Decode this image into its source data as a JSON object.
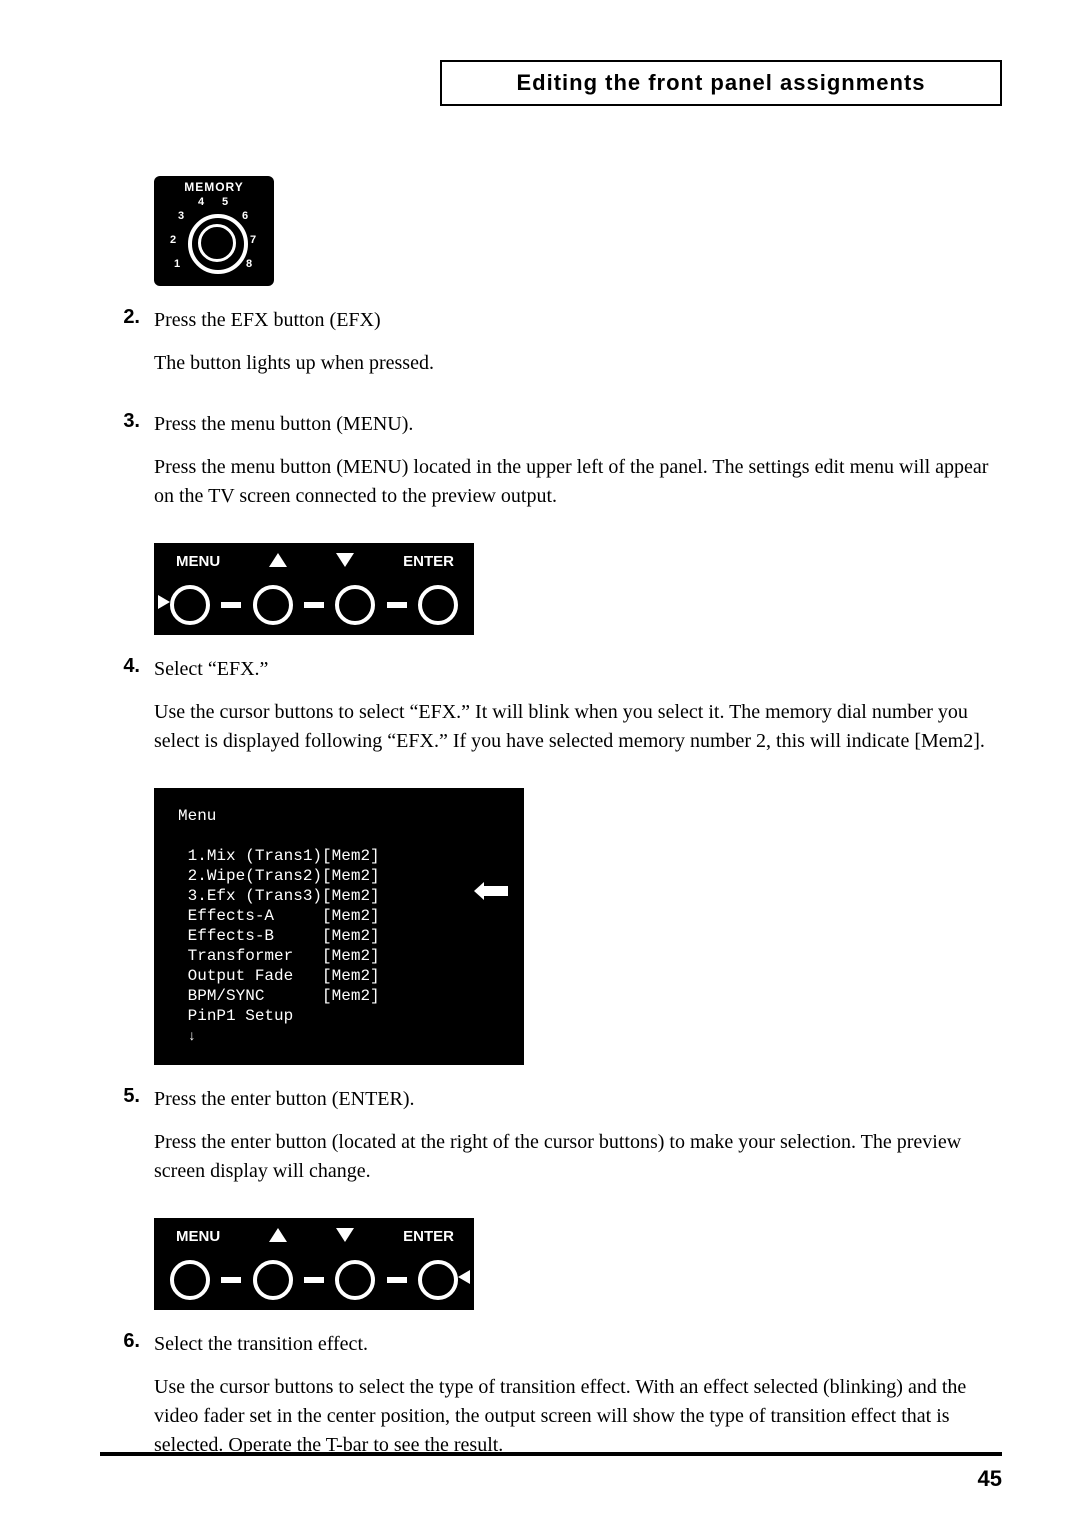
{
  "header": {
    "title": "Editing the front panel assignments"
  },
  "memory_dial": {
    "label": "MEMORY",
    "numbers": [
      "1",
      "2",
      "3",
      "4",
      "5",
      "6",
      "7",
      "8"
    ]
  },
  "menu_strip": {
    "menu_label": "MENU",
    "enter_label": "ENTER"
  },
  "screen_menu": {
    "title": "Menu",
    "lines": [
      "1.Mix (Trans1)[Mem2]",
      "2.Wipe(Trans2)[Mem2]",
      "3.Efx (Trans3)[Mem2]",
      "Effects-A     [Mem2]",
      "Effects-B     [Mem2]",
      "Transformer   [Mem2]",
      "Output Fade   [Mem2]",
      "BPM/SYNC      [Mem2]",
      "PinP1 Setup"
    ]
  },
  "steps": {
    "s2": {
      "num": "2.",
      "title": "Press the EFX button (EFX)",
      "body": "The button lights up when pressed."
    },
    "s3": {
      "num": "3.",
      "title": "Press the menu button (MENU).",
      "body": "Press the menu button (MENU) located in the upper left of the panel. The settings edit menu will appear on the TV screen connected to the preview output."
    },
    "s4": {
      "num": "4.",
      "title": "Select “EFX.”",
      "body": "Use the cursor buttons to select “EFX.” It will blink when you select it. The memory dial number you select is displayed following “EFX.” If you have selected memory number 2, this will indicate [Mem2]."
    },
    "s5": {
      "num": "5.",
      "title": "Press the enter button (ENTER).",
      "body": "Press the enter button (located at the right of the cursor buttons) to make your selection. The preview screen display will change."
    },
    "s6": {
      "num": "6.",
      "title": "Select the transition effect.",
      "body": "Use the cursor buttons to select the type of transition effect. With an effect selected (blinking) and the video fader set in the center position, the output screen will show the type of transition effect that is selected. Operate the T-bar to see the result."
    }
  },
  "page_number": "45"
}
